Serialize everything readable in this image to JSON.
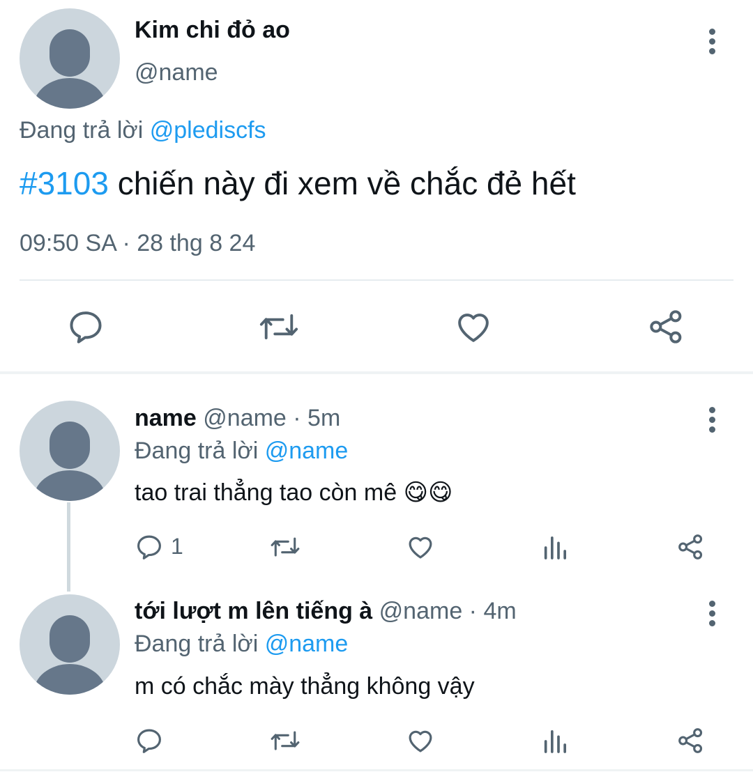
{
  "main_tweet": {
    "display_name": "Kim chi đỏ ao",
    "handle": "@name",
    "replying_prefix": "Đang trả lời",
    "replying_to": "@plediscfs",
    "hashtag": "#3103",
    "text": " chiến này đi xem về chắc đẻ hết",
    "timestamp": "09:50 SA · 28 thg 8 24"
  },
  "replies": [
    {
      "display_name": "name",
      "meta": "@name · 5m",
      "replying_prefix": "Đang trả lời",
      "replying_to": "@name",
      "text": "tao trai thẳng tao còn mê 😋😋",
      "reply_count": "1"
    },
    {
      "display_name": "tới lượt m lên tiếng à",
      "meta": "@name · 4m",
      "replying_prefix": "Đang trả lời",
      "replying_to": "@name",
      "text": "m có chắc mày thẳng không vậy",
      "reply_count": ""
    }
  ],
  "icons": {
    "reply": "reply-icon",
    "retweet": "retweet-icon",
    "like": "heart-icon",
    "views": "views-icon",
    "share": "share-icon",
    "more": "more-vertical-icon"
  },
  "colors": {
    "accent": "#1d9bf0",
    "muted": "#536471",
    "avatar": "#ccd6dd"
  }
}
